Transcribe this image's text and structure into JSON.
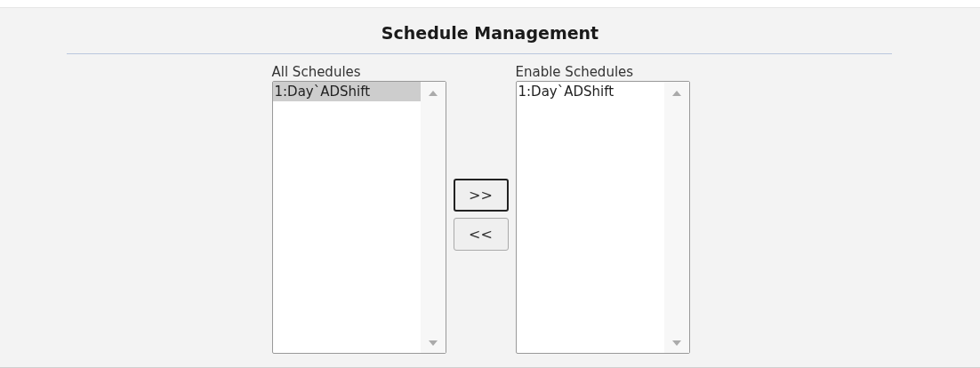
{
  "title": "Schedule Management",
  "lists": [
    {
      "label": "All Schedules",
      "items": [
        {
          "text": "1:Day`ADShift",
          "selected": true
        }
      ]
    },
    {
      "label": "Enable Schedules",
      "items": [
        {
          "text": "1:Day`ADShift",
          "selected": false
        }
      ]
    }
  ],
  "buttons": [
    {
      "label": ">>",
      "focused": true
    },
    {
      "label": "<<",
      "focused": false
    }
  ]
}
